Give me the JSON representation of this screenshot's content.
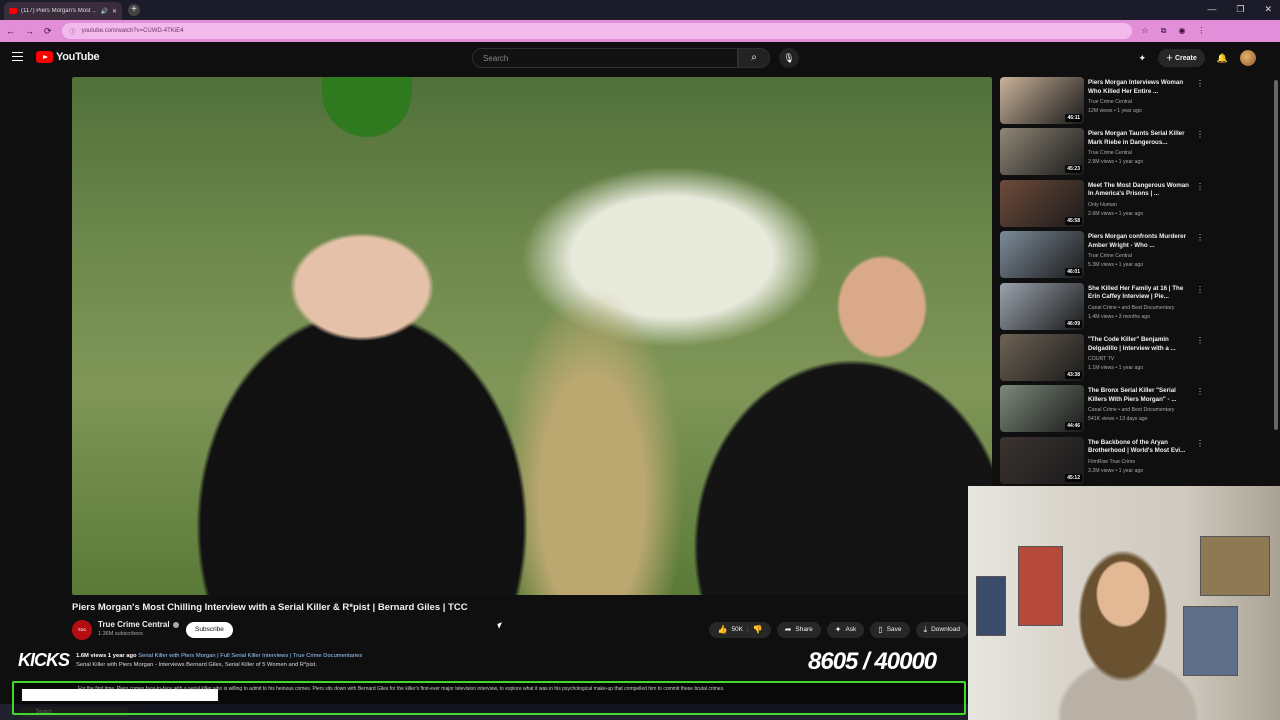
{
  "browser": {
    "tab_title": "(117) Piers Morgan's Most ...",
    "new_tab": "+",
    "url": "youtube.com/watch?v=CUWD-4TKiE4",
    "window_controls": [
      "—",
      "❐",
      "✕"
    ]
  },
  "masthead": {
    "logo_text": "YouTube",
    "search_placeholder": "Search",
    "create_label": "Create"
  },
  "video": {
    "title": "Piers Morgan's Most Chilling Interview with a Serial Killer & R*pist | Bernard Giles | TCC",
    "channel_name": "True Crime Central",
    "subscribers": "1.36M subscribers",
    "subscribe_label": "Subscribe",
    "likes": "50K",
    "share_label": "Share",
    "ask_label": "Ask",
    "save_label": "Save",
    "download_label": "Download"
  },
  "description": {
    "views": "1.6M views",
    "age": "1 year ago",
    "hashtags": "Serial Killer with Piers Morgan | Full Serial Killer Interviews | True Crime Documentaries",
    "line1": "Serial Killer with Piers Morgan - Interviews Bernard Giles, Serial Killer of 5 Women and R*pist."
  },
  "overlay": {
    "kicks_logo": "KICKS",
    "counter": "8605  / 40000",
    "ticker": "For the first time, Piers comes face-to-face with a serial killer who is willing to admit to his heinous crimes. Piers sits down with Bernard Giles for the killer's first-ever major television interview, to explore what it was in his psychological make-up that compelled him to commit these brutal crimes."
  },
  "taskbar": {
    "search": "Search"
  },
  "recommendations": [
    {
      "title": "Piers Morgan Interviews Woman Who Killed Her Entire ...",
      "channel": "True Crime Central",
      "meta": "12M views • 1 year ago",
      "duration": "46:11",
      "thumb_color": "#c9b29a"
    },
    {
      "title": "Piers Morgan Taunts Serial Killer Mark Riebe in Dangerous...",
      "channel": "True Crime Central",
      "meta": "2.9M views • 1 year ago",
      "duration": "45:23",
      "thumb_color": "#8f8676"
    },
    {
      "title": "Meet The Most Dangerous Woman In America's Prisons | ...",
      "channel": "Only Human",
      "meta": "2.6M views • 1 year ago",
      "duration": "45:58",
      "thumb_color": "#6e4b3a"
    },
    {
      "title": "Piers Morgan confronts Murderer Amber Wright - Who ...",
      "channel": "True Crime Central",
      "meta": "5.3M views • 1 year ago",
      "duration": "46:01",
      "thumb_color": "#7c8b99"
    },
    {
      "title": "She Killed Her Family at 16 | The Erin Caffey Interview | Pie...",
      "channel": "Canal Crime • and Best Documentary",
      "meta": "1.4M views • 3 months ago",
      "duration": "46:09",
      "thumb_color": "#9aa3ad"
    },
    {
      "title": "\"The Code Killer\" Benjamin Delgadillo | Interview with a ...",
      "channel": "COURT TV",
      "meta": "1.1M views • 1 year ago",
      "duration": "43:38",
      "thumb_color": "#6d6254"
    },
    {
      "title": "The Bronx Serial Killer \"Serial Killers With Piers Morgan\" - ...",
      "channel": "Canal Crime • and Best Documentary",
      "meta": "541K views • 13 days ago",
      "duration": "44:46",
      "thumb_color": "#7b8a7a"
    },
    {
      "title": "The Backbone of the Aryan Brotherhood | World's Most Evi...",
      "channel": "FilmRise True Crime",
      "meta": "3.2M views • 1 year ago",
      "duration": "45:12",
      "thumb_color": "#3b3431"
    }
  ]
}
